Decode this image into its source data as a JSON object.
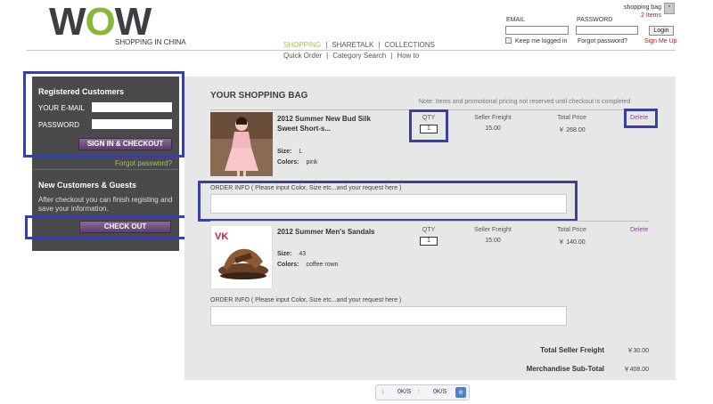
{
  "header": {
    "logo_text": "WOW",
    "tagline": "SHOPPING IN CHINA",
    "nav_primary": [
      "SHOPPING",
      "SHARETALK",
      "COLLECTIONS"
    ],
    "nav_secondary": [
      "Quick Order",
      "Category Search",
      "How to"
    ],
    "bag_label": "shopping bag",
    "bag_count": "2 Items",
    "bag_icon": "shopping-bag-icon",
    "login": {
      "email_label": "EMAIL",
      "password_label": "PASSWORD",
      "login_button": "Login",
      "keep_logged_in": "Keep me logged in",
      "forgot_password": "Forgot password?",
      "sign_up": "Sign Me Up"
    }
  },
  "sidebar": {
    "registered_title": "Registered Customers",
    "email_label": "YOUR E-MAIL",
    "password_label": "PASSWORD",
    "signin_button": "SIGN IN & CHECKOUT",
    "forgot_password": "Forgot password?",
    "guest_title": "New Customers & Guests",
    "guest_text": "After checkout you can finish registing and save your information.",
    "checkout_button": "CHECK OUT"
  },
  "bag": {
    "title": "YOUR SHOPPING BAG",
    "note": "Note: Items and promotional pricing not reserved until checkout is completed",
    "headers": {
      "qty": "QTY",
      "freight": "Seller Freight",
      "total": "Total Price"
    },
    "order_info_label": "ORDER INFO ( Please input Color, Size etc...and your request here )",
    "items": [
      {
        "name_line1": "2012 Summer New Bud Silk",
        "name_line2": "Sweet Short-s...",
        "qty": "1",
        "freight": "15.00",
        "total": "￥ 268.00",
        "size_label": "Size:",
        "size": "L",
        "colors_label": "Colors:",
        "colors": "pink",
        "delete": "Delete",
        "order_info_value": ""
      },
      {
        "name_line1": "2012 Summer Men's Sandals",
        "name_line2": "",
        "qty": "1",
        "freight": "15.00",
        "total": "￥ 140.00",
        "size_label": "Size:",
        "size": "43",
        "colors_label": "Colors:",
        "colors": "coffee rown",
        "delete": "Delete",
        "order_info_value": ""
      }
    ],
    "totals": {
      "freight_label": "Total Seller Freight",
      "freight_value": "￥30.00",
      "subtotal_label": "Merchandise Sub-Total",
      "subtotal_value": "￥408.00"
    }
  },
  "status_bar": {
    "download": "0K/S",
    "upload": "0K/S",
    "download_icon": "arrow-down-icon",
    "upload_icon": "arrow-up-icon",
    "browser_icon": "browser-icon"
  },
  "colors": {
    "sidebar_bg": "#4a4a4d",
    "button_purple": "#6b4a7c",
    "accent_green": "#a3c25a",
    "annotation_blue": "#3b3f9e",
    "link_purple": "#8b4a9c"
  }
}
